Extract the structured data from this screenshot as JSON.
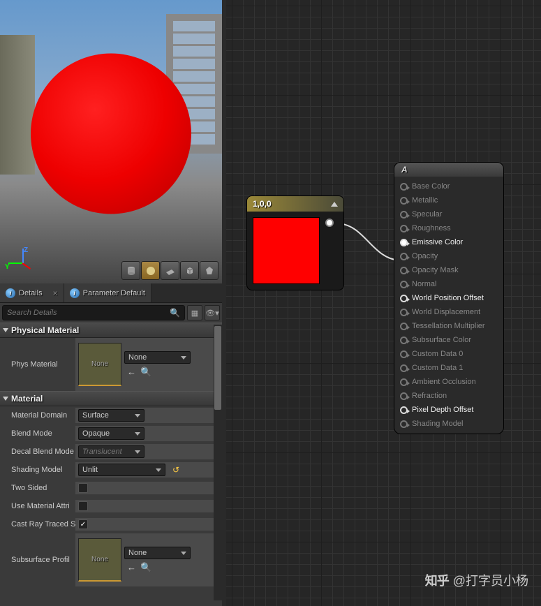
{
  "tabs": {
    "details": "Details",
    "parameter_defaults": "Parameter Default"
  },
  "search": {
    "placeholder": "Search Details"
  },
  "sections": {
    "physical_material": "Physical Material",
    "material": "Material"
  },
  "phys_material": {
    "label": "Phys Material",
    "thumb_text": "None",
    "dropdown": "None"
  },
  "material_props": {
    "domain": {
      "label": "Material Domain",
      "value": "Surface"
    },
    "blend": {
      "label": "Blend Mode",
      "value": "Opaque"
    },
    "decal": {
      "label": "Decal Blend Mode",
      "value": "Translucent"
    },
    "shading": {
      "label": "Shading Model",
      "value": "Unlit"
    },
    "two_sided": {
      "label": "Two Sided",
      "checked": false
    },
    "use_attr": {
      "label": "Use Material Attri",
      "checked": false
    },
    "cast_ray": {
      "label": "Cast Ray Traced S",
      "checked": true
    },
    "subsurface": {
      "label": "Subsurface Profil",
      "thumb_text": "None",
      "dropdown": "None"
    }
  },
  "const_node": {
    "title": "1,0,0",
    "color": "#ff0000"
  },
  "mat_node": {
    "title": "A",
    "pins": [
      {
        "name": "Base Color",
        "enabled": false
      },
      {
        "name": "Metallic",
        "enabled": false
      },
      {
        "name": "Specular",
        "enabled": false
      },
      {
        "name": "Roughness",
        "enabled": false
      },
      {
        "name": "Emissive Color",
        "enabled": true,
        "connected": true
      },
      {
        "name": "Opacity",
        "enabled": false
      },
      {
        "name": "Opacity Mask",
        "enabled": false
      },
      {
        "name": "Normal",
        "enabled": false
      },
      {
        "name": "World Position Offset",
        "enabled": true
      },
      {
        "name": "World Displacement",
        "enabled": false
      },
      {
        "name": "Tessellation Multiplier",
        "enabled": false
      },
      {
        "name": "Subsurface Color",
        "enabled": false
      },
      {
        "name": "Custom Data 0",
        "enabled": false
      },
      {
        "name": "Custom Data 1",
        "enabled": false
      },
      {
        "name": "Ambient Occlusion",
        "enabled": false
      },
      {
        "name": "Refraction",
        "enabled": false
      },
      {
        "name": "Pixel Depth Offset",
        "enabled": true
      },
      {
        "name": "Shading Model",
        "enabled": false
      }
    ]
  },
  "watermark": "@打字员小杨",
  "axis": {
    "z": "Z",
    "y": "Y"
  }
}
